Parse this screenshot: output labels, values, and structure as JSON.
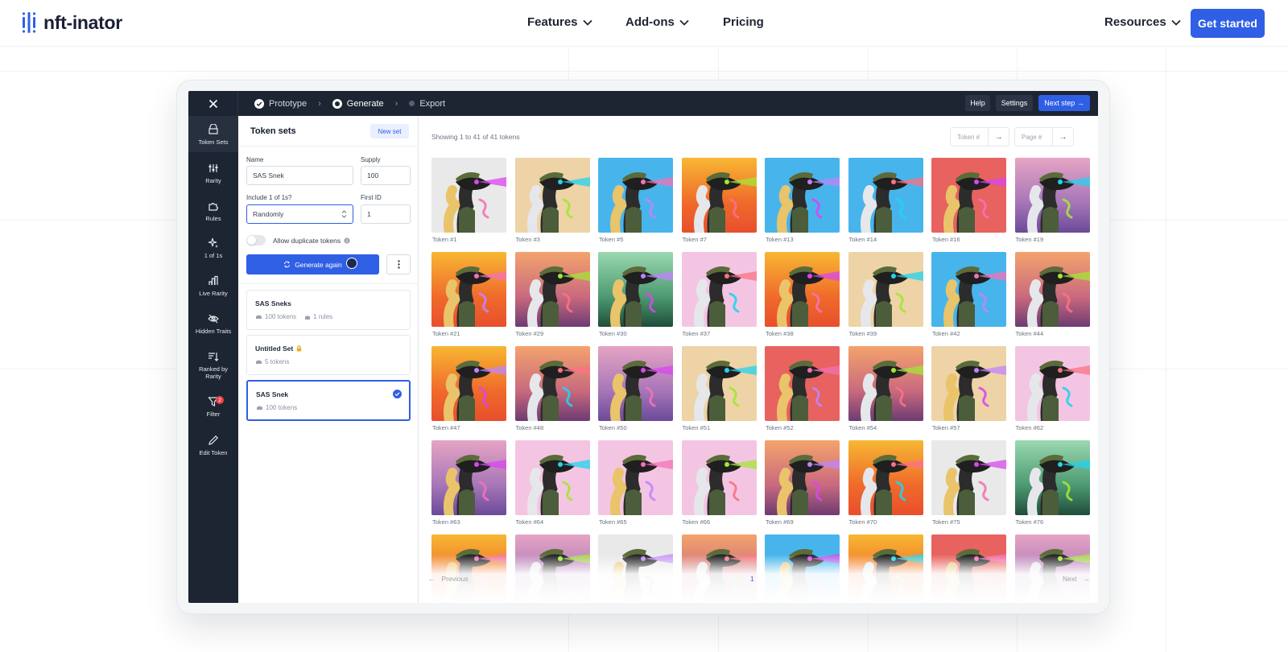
{
  "brand": {
    "name": "nft-inator"
  },
  "nav": {
    "features": "Features",
    "addons": "Add-ons",
    "pricing": "Pricing",
    "resources": "Resources",
    "cta": "Get started"
  },
  "app": {
    "steps": [
      "Prototype",
      "Generate",
      "Export"
    ],
    "help": "Help",
    "settings": "Settings",
    "next_step": "Next step →",
    "sidebar": [
      {
        "label": "Token Sets",
        "icon": "token-sets-icon",
        "active": true
      },
      {
        "label": "Rarity",
        "icon": "sliders-icon"
      },
      {
        "label": "Rules",
        "icon": "puzzle-icon"
      },
      {
        "label": "1 of 1s",
        "icon": "sparkles-icon"
      },
      {
        "label": "Live Rarity",
        "icon": "bar-chart-icon"
      },
      {
        "label": "Hidden Traits",
        "icon": "eye-off-icon"
      },
      {
        "label": "Ranked by Rarity",
        "icon": "sort-icon"
      },
      {
        "label": "Filter",
        "icon": "filter-icon",
        "badge": "2"
      },
      {
        "label": "Edit Token",
        "icon": "pencil-icon"
      }
    ],
    "panel": {
      "title": "Token sets",
      "new_set": "New set",
      "name_label": "Name",
      "name_value": "SAS Snek",
      "supply_label": "Supply",
      "supply_value": "100",
      "include_label": "Include 1 of 1s?",
      "include_value": "Randomly",
      "first_id_label": "First ID",
      "first_id_value": "1",
      "allow_dup": "Allow duplicate tokens",
      "generate": "Generate again",
      "sets": [
        {
          "name": "SAS Sneks",
          "tokens": "100 tokens",
          "rules": "1 rules",
          "locked": false,
          "selected": false
        },
        {
          "name": "Untitled Set",
          "tokens": "5 tokens",
          "rules": "",
          "locked": true,
          "selected": false
        },
        {
          "name": "SAS Snek",
          "tokens": "100 tokens",
          "rules": "",
          "locked": false,
          "selected": true
        }
      ]
    },
    "main": {
      "showing": "Showing 1 to 41 of 41 tokens",
      "token_placeholder": "Token #",
      "page_placeholder": "Page #",
      "prev": "Previous",
      "page": "1",
      "next": "Next",
      "tokens": [
        {
          "label": "Token #1",
          "bg": "#e9e9e9"
        },
        {
          "label": "Token #3",
          "bg": "#edd3a6"
        },
        {
          "label": "Token #5",
          "bg": "#47b5ec"
        },
        {
          "label": "Token #7",
          "bg": "orange"
        },
        {
          "label": "Token #13",
          "bg": "#47b5ec"
        },
        {
          "label": "Token #14",
          "bg": "#47b5ec"
        },
        {
          "label": "Token #16",
          "bg": "#e8625f"
        },
        {
          "label": "Token #19",
          "bg": "purple"
        },
        {
          "label": "Token #21",
          "bg": "orange"
        },
        {
          "label": "Token #29",
          "bg": "sunset"
        },
        {
          "label": "Token #30",
          "bg": "green"
        },
        {
          "label": "Token #37",
          "bg": "#f4c5e3"
        },
        {
          "label": "Token #38",
          "bg": "orange"
        },
        {
          "label": "Token #39",
          "bg": "#edd3a6"
        },
        {
          "label": "Token #42",
          "bg": "#47b5ec"
        },
        {
          "label": "Token #44",
          "bg": "sunset"
        },
        {
          "label": "Token #47",
          "bg": "orange"
        },
        {
          "label": "Token #48",
          "bg": "sunset"
        },
        {
          "label": "Token #50",
          "bg": "purple"
        },
        {
          "label": "Token #51",
          "bg": "#edd3a6"
        },
        {
          "label": "Token #52",
          "bg": "#e8625f"
        },
        {
          "label": "Token #54",
          "bg": "sunset"
        },
        {
          "label": "Token #57",
          "bg": "#edd3a6"
        },
        {
          "label": "Token #62",
          "bg": "#f4c5e3"
        },
        {
          "label": "Token #63",
          "bg": "purple"
        },
        {
          "label": "Token #64",
          "bg": "#f4c5e3"
        },
        {
          "label": "Token #65",
          "bg": "#f4c5e3"
        },
        {
          "label": "Token #66",
          "bg": "#f4c5e3"
        },
        {
          "label": "Token #69",
          "bg": "sunset"
        },
        {
          "label": "Token #70",
          "bg": "orange"
        },
        {
          "label": "Token #75",
          "bg": "#e9e9e9"
        },
        {
          "label": "Token #76",
          "bg": "green"
        },
        {
          "label": "",
          "bg": "orange"
        },
        {
          "label": "",
          "bg": "purple"
        },
        {
          "label": "",
          "bg": "#e9e9e9"
        },
        {
          "label": "",
          "bg": "sunset"
        },
        {
          "label": "",
          "bg": "#47b5ec"
        },
        {
          "label": "",
          "bg": "orange"
        },
        {
          "label": "",
          "bg": "#e8625f"
        },
        {
          "label": "",
          "bg": "purple"
        }
      ]
    }
  },
  "colors": {
    "accent": "#2f5fe4",
    "dark": "#1d2533"
  }
}
